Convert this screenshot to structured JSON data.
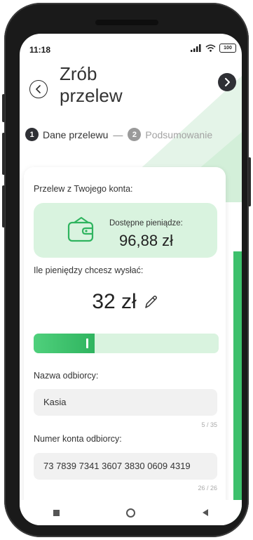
{
  "status_bar": {
    "time": "11:18",
    "battery": "100",
    "signal_icon": "signal-icon",
    "wifi_icon": "wifi-icon"
  },
  "header": {
    "title": "Zrób przelew",
    "back_icon": "chevron-left-icon",
    "next_icon": "chevron-right-icon"
  },
  "steps": [
    {
      "number": "1",
      "label": "Dane przelewu",
      "active": true
    },
    {
      "number": "2",
      "label": "Podsumowanie",
      "active": false
    }
  ],
  "step_separator": "—",
  "form": {
    "source_label": "Przelew z Twojego konta:",
    "balance_label": "Dostępne pieniądze:",
    "balance_value": "96,88 zł",
    "amount_label": "Ile pieniędzy chcesz wysłać:",
    "amount_value": "32 zł",
    "amount_fraction": 0.33,
    "recipient_name_label": "Nazwa odbiorcy:",
    "recipient_name_value": "Kasia",
    "recipient_name_counter": "5 / 35",
    "account_label": "Numer konta odbiorcy:",
    "account_value": "73 7839 7341 3607 3830 0609 4319",
    "account_counter": "26 / 26"
  },
  "colors": {
    "accent": "#3dc06c",
    "accent_light": "#d9f3df",
    "dark": "#2f3035"
  }
}
